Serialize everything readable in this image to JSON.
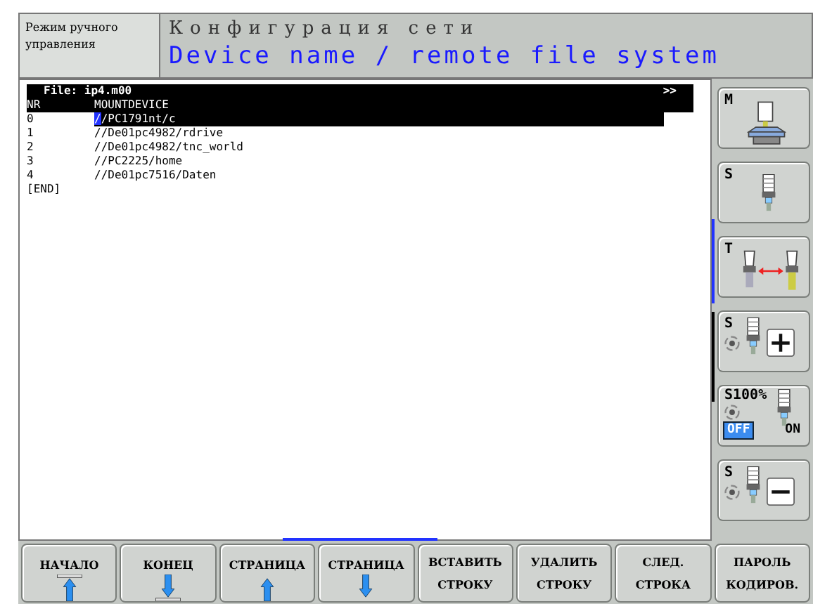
{
  "mode": {
    "label": "Режим ручного управления"
  },
  "header": {
    "title": "Конфигурация сети",
    "subtitle": "Device name / remote file system"
  },
  "file": {
    "name": "File: ip4.m00",
    "more": ">>"
  },
  "table": {
    "columns": [
      "NR",
      "MOUNTDEVICE"
    ],
    "rows": [
      {
        "nr": "0",
        "device": "//PC1791nt/c",
        "selected": true
      },
      {
        "nr": "1",
        "device": "//De01pc4982/rdrive",
        "selected": false
      },
      {
        "nr": "2",
        "device": "//De01pc4982/tnc_world",
        "selected": false
      },
      {
        "nr": "3",
        "device": "//PC2225/home",
        "selected": false
      },
      {
        "nr": "4",
        "device": "//De01pc7516/Daten",
        "selected": false
      }
    ],
    "end": "[END]"
  },
  "side_keys": [
    {
      "kind": "machine",
      "label": "M"
    },
    {
      "kind": "spindle",
      "label": "S"
    },
    {
      "kind": "tool-change",
      "label": "T"
    },
    {
      "kind": "spindle-plus",
      "label": "S"
    },
    {
      "kind": "spindle-override",
      "label": "S100%",
      "options": [
        {
          "label": "OFF",
          "selected": true
        },
        {
          "label": "ON",
          "selected": false
        }
      ]
    },
    {
      "kind": "spindle-minus",
      "label": "S"
    }
  ],
  "softkeys": [
    {
      "kind": "home",
      "label": "НАЧАЛО"
    },
    {
      "kind": "end",
      "label": "КОНЕЦ"
    },
    {
      "kind": "page-up",
      "label": "СТРАНИЦА"
    },
    {
      "kind": "page-down",
      "label": "СТРАНИЦА"
    },
    {
      "kind": "text",
      "lines": [
        "ВСТАВИТЬ",
        "СТРОКУ"
      ]
    },
    {
      "kind": "text",
      "lines": [
        "УДАЛИТЬ",
        "СТРОКУ"
      ]
    },
    {
      "kind": "text",
      "lines": [
        "СЛЕД.",
        "СТРОКА"
      ]
    },
    {
      "kind": "text",
      "lines": [
        "ПАРОЛЬ",
        "КОДИРОВ."
      ]
    }
  ]
}
